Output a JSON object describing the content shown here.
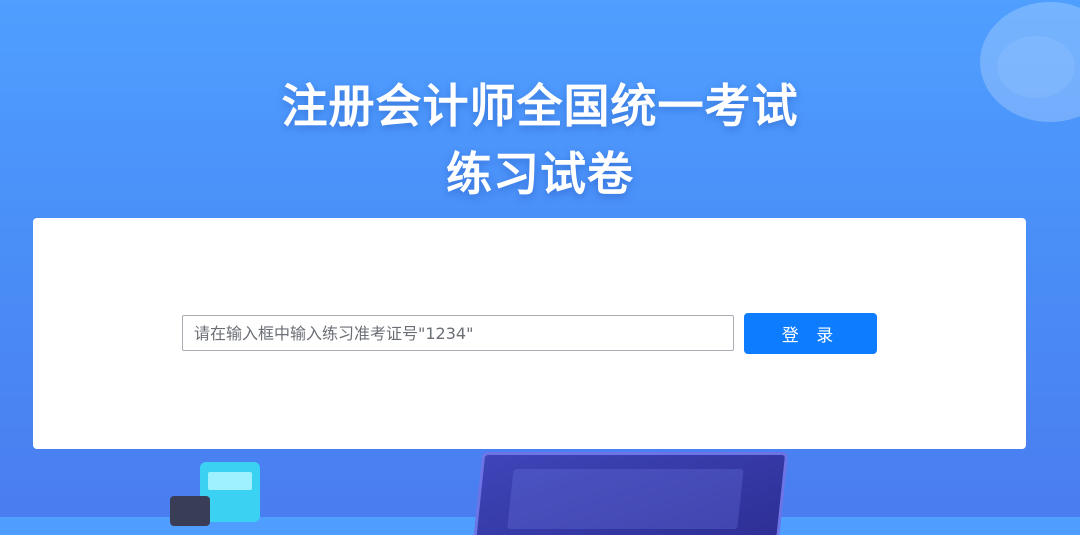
{
  "header": {
    "title_line1": "注册会计师全国统一考试",
    "title_line2": "练习试卷"
  },
  "login": {
    "input_value": "",
    "input_placeholder": "请在输入框中输入练习准考证号\"1234\"",
    "button_label": "登 录"
  },
  "colors": {
    "background_top": "#4f9fff",
    "background_bottom": "#4a7df0",
    "button": "#0d7cff",
    "card": "#ffffff"
  },
  "icons": [
    "decorative-circle",
    "laptop-illustration",
    "calculator-illustration"
  ]
}
